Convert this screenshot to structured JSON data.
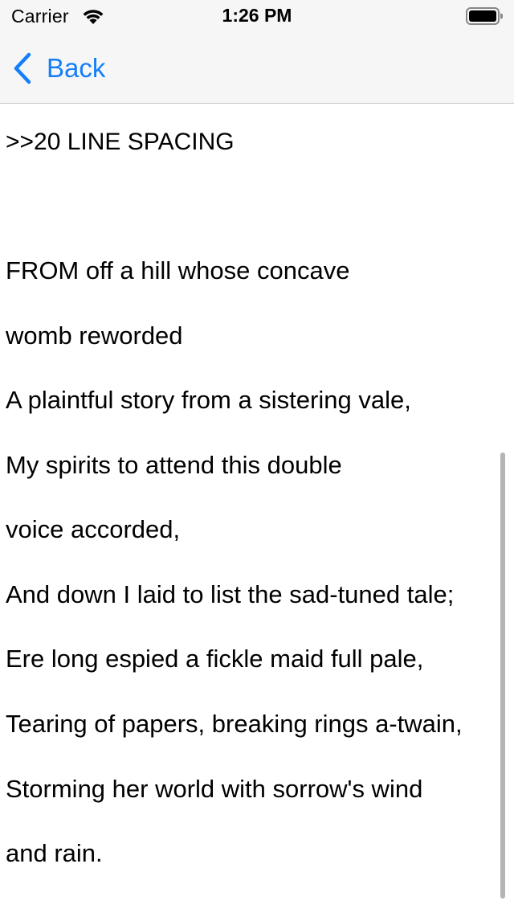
{
  "status_bar": {
    "carrier": "Carrier",
    "time": "1:26 PM",
    "wifi_icon": "wifi-icon",
    "battery_icon": "battery-icon"
  },
  "nav_bar": {
    "back_label": "Back",
    "back_icon": "chevron-left-icon",
    "accent_color": "#147efb"
  },
  "content": {
    "heading": ">>20 LINE SPACING",
    "lines": [
      "FROM off a hill whose concave",
      "womb reworded",
      "A plaintful story from a sistering vale,",
      "My spirits to attend this double",
      "voice accorded,",
      "And down I laid to list the sad-tuned tale;",
      "Ere long espied a fickle maid full pale,",
      "Tearing of papers, breaking rings a-twain,",
      "Storming her world with sorrow's wind",
      "and rain."
    ]
  }
}
